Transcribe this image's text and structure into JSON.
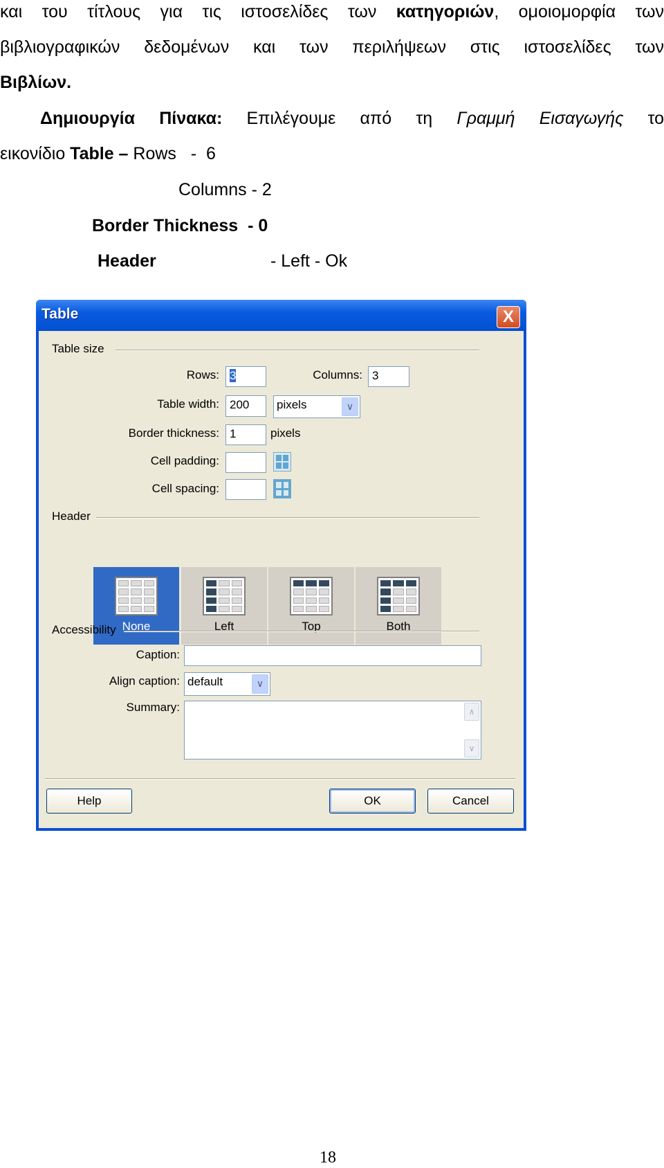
{
  "document": {
    "line1": {
      "a": "και του τίτλους για τις ιστοσελίδες των ",
      "b": "κατηγοριών",
      "c": ", ομοιομορφία των"
    },
    "line2": "βιβλιογραφικών δεδομένων και των περιλήψεων στις ιστοσελίδες των",
    "line3": "Βιβλίων.",
    "line4": {
      "bold": "Δημιουργία Πίνακα:",
      "text": " Επιλέγουμε από τη ",
      "italic": "Γραμμή Εισαγωγής",
      "end": " το"
    },
    "line5": {
      "text": "εικονίδιο ",
      "bold": "Table –",
      "end": " Rows   -  6"
    },
    "line6": "Columns - 2",
    "line7": "Border Thickness  - 0",
    "line8": {
      "bold": "Header",
      "end": "-  Left - Ok"
    },
    "page_number": "18"
  },
  "dialog": {
    "title": "Table",
    "close": "X",
    "table_size": {
      "group_label": "Table size",
      "rows_label": "Rows:",
      "rows_value": "3",
      "columns_label": "Columns:",
      "columns_value": "3",
      "width_label": "Table width:",
      "width_value": "200",
      "width_unit": "pixels",
      "border_label": "Border thickness:",
      "border_value": "1",
      "border_unit": "pixels",
      "padding_label": "Cell padding:",
      "padding_value": "",
      "spacing_label": "Cell spacing:",
      "spacing_value": ""
    },
    "header": {
      "group_label": "Header",
      "options": [
        {
          "label": "None",
          "selected": true
        },
        {
          "label": "Left",
          "selected": false
        },
        {
          "label": "Top",
          "selected": false
        },
        {
          "label": "Both",
          "selected": false
        }
      ]
    },
    "accessibility": {
      "group_label": "Accessibility",
      "caption_label": "Caption:",
      "caption_value": "",
      "align_label": "Align caption:",
      "align_value": "default",
      "summary_label": "Summary:",
      "summary_value": ""
    },
    "buttons": {
      "help": "Help",
      "ok": "OK",
      "cancel": "Cancel"
    },
    "colors": {
      "title_bar": "#0a5ae0",
      "body": "#ece9d8",
      "selected": "#316ac5"
    }
  }
}
